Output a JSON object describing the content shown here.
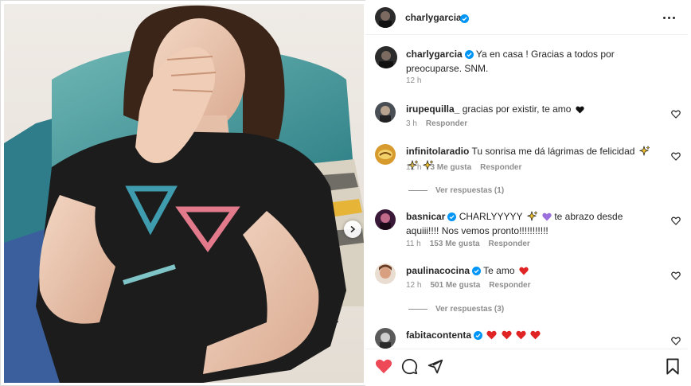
{
  "post": {
    "author": "charlygarcia",
    "more_icon": "more-horizontal-icon"
  },
  "caption": {
    "username": "charlygarcia",
    "text": "Ya en casa ! Gracias a todos por preocuparse. SNM.",
    "time": "12 h"
  },
  "comments": [
    {
      "username": "irupequilla_",
      "verified": false,
      "text": "gracias por existir, te amo",
      "emojis": [
        "black-heart"
      ],
      "time": "3 h",
      "likes": "",
      "reply": "Responder"
    },
    {
      "username": "infinitolaradio",
      "verified": false,
      "text": "Tu sonrisa me dá lágrimas de felicidad",
      "emojis": [
        "sparkles",
        "sparkles",
        "sparkles"
      ],
      "time": "12 h",
      "likes": "3 Me gusta",
      "reply": "Responder",
      "view_replies": "Ver respuestas (1)"
    },
    {
      "username": "basnicar",
      "verified": true,
      "text": "CHARLYYYYY",
      "emojis": [
        "sparkles",
        "purple-heart"
      ],
      "text2": "te abrazo desde aquiii!!!! Nos vemos pronto!!!!!!!!!!!",
      "time": "11 h",
      "likes": "153 Me gusta",
      "reply": "Responder"
    },
    {
      "username": "paulinacocina",
      "verified": true,
      "text": "Te amo",
      "emojis": [
        "red-heart"
      ],
      "time": "12 h",
      "likes": "501 Me gusta",
      "reply": "Responder",
      "view_replies": "Ver respuestas (3)"
    },
    {
      "username": "fabitacontenta",
      "verified": true,
      "text": "",
      "emojis": [
        "red-heart",
        "red-heart",
        "red-heart",
        "red-heart"
      ]
    }
  ],
  "actions": {
    "like_icon": "heart-filled-icon",
    "comment_icon": "comment-icon",
    "share_icon": "send-icon",
    "save_icon": "bookmark-icon"
  },
  "colors": {
    "verified": "#0095f6",
    "like_red": "#ed4956",
    "muted": "#8e8e8e",
    "text": "#262626"
  }
}
